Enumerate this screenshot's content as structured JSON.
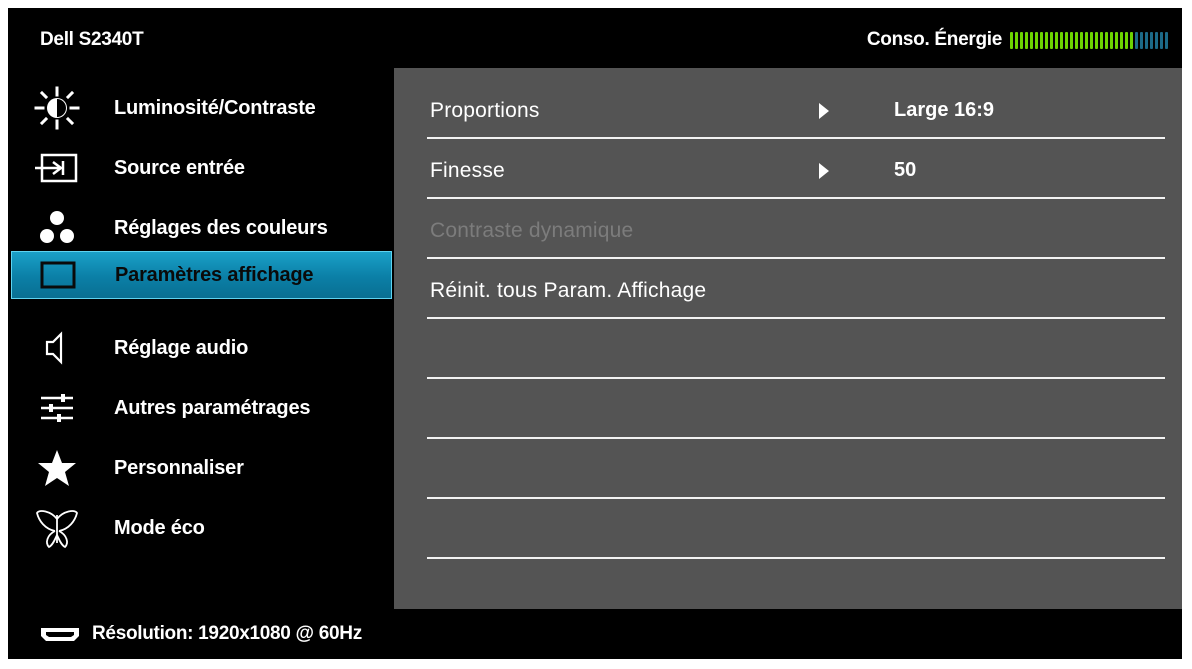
{
  "header": {
    "model": "Dell S2340T",
    "energy_label": "Conso. Énergie",
    "energy_level": 0.78,
    "energy_colors": {
      "active": "#6dd400",
      "inactive": "#1c6a88"
    }
  },
  "sidebar": {
    "items": [
      {
        "label": "Luminosité/Contraste",
        "icon": "brightness-icon"
      },
      {
        "label": "Source entrée",
        "icon": "input-source-icon"
      },
      {
        "label": "Réglages des couleurs",
        "icon": "color-dots-icon"
      },
      {
        "label": "Paramètres affichage",
        "icon": "display-rectangle-icon",
        "active": true
      },
      {
        "label": "Réglage audio",
        "icon": "speaker-icon"
      },
      {
        "label": "Autres paramétrages",
        "icon": "sliders-icon"
      },
      {
        "label": "Personnaliser",
        "icon": "star-icon"
      },
      {
        "label": "Mode éco",
        "icon": "butterfly-icon"
      }
    ],
    "active_color": "#0b87b0"
  },
  "panel": {
    "rows": [
      {
        "label": "Proportions",
        "value": "Large 16:9",
        "has_arrow": true
      },
      {
        "label": "Finesse",
        "value": "50",
        "has_arrow": true
      },
      {
        "label": "Contraste dynamique",
        "value": "",
        "disabled": true
      },
      {
        "label": "Réinit. tous Param. Affichage",
        "value": ""
      },
      {
        "label": "",
        "value": ""
      },
      {
        "label": "",
        "value": ""
      },
      {
        "label": "",
        "value": ""
      },
      {
        "label": "",
        "value": ""
      }
    ],
    "background": "#545454"
  },
  "footer": {
    "resolution_text": "Résolution: 1920x1080 @ 60Hz",
    "icon": "hdmi-connector-icon"
  }
}
